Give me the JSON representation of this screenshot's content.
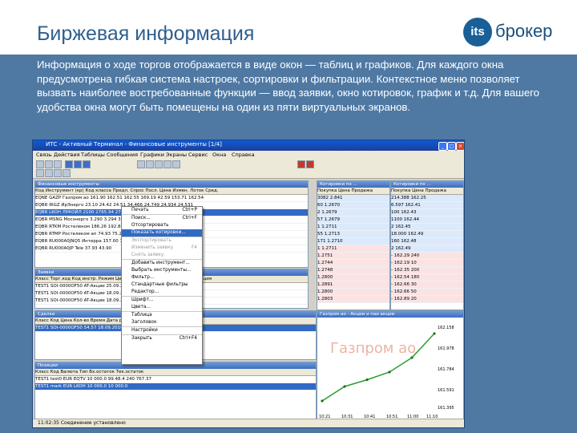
{
  "slide": {
    "title": "Биржевая информация",
    "logo_mark": "its",
    "logo_text": "брокер",
    "description": "Информация о ходе торгов отображается в виде окон — таблиц и графиков. Для каждого окна предусмотрена гибкая система настроек, сортировки и фильтрации. Контекстное меню позволяет вызвать наиболее востребованные функции — ввод заявки, окно котировок, график и т.д. Для вашего удобства окна могут быть помещены на один из пяти виртуальных экранов."
  },
  "app": {
    "title": "ИТС - Активный Терминал - Финансовые инструменты [1/4]",
    "menu": [
      "Связь",
      "Действия",
      "Таблицы",
      "Сообщения",
      "Графики",
      "Экраны",
      "Сервис",
      "Окна",
      "Справка"
    ],
    "status": "11:02:35 Соединение установлено"
  },
  "instruments": {
    "title": "Финансовые инструменты",
    "columns": "Код    Инструмент (кр)    Код класса    Предл.    Спрос    Посл.    Цена    Измен.    Лоток    Сред.",
    "rows": [
      "EQNE  GAZP   Газпром ао   161.90  162.51  162.55  169.19  42.59  153.71  162.54",
      "EQBR  IRGZ   ИрЭнерго   23.10  24.42  24.51  34.466  24.749  24.934  24.531",
      "EQBR  LKOH   ЛУКОЙЛ   2100  2765.94  2765.50  2765.00  2763.70  2754.00",
      "EQBR  MSNG   Мосэнерго   3.290  3.294  3.340  3.245  3.247",
      "EQBR  RTKM   Ростелеком   186.26  192.86  183.03  186.34",
      "EQBR  RTMP   Ростелеком ап   74.93  75.20  74.80",
      "EQBR  RU000A0JNQ5   Интерра   157.00  155.01  149.77  152.55",
      "EQBR  RU000A0JP   Tele   37.93  43.90"
    ]
  },
  "quotes1": {
    "title": "Котировки по ...",
    "columns": "Покупка   Цена   Продажа",
    "rows": [
      "3082   2.841",
      "60   1.2670",
      "2   1.2679",
      "57   1.2679",
      "1   1.2711",
      "55   1.2713",
      "171   1.2710",
      "1   1.2711",
      "   1.2751",
      "   1.2744",
      "   1.2748",
      "   1.2800",
      "   1.2891",
      "   1.2800",
      "   1.2803"
    ]
  },
  "quotes2": {
    "title": "Котировки по ...",
    "columns": "Покупка   Цена   Продажа",
    "rows": [
      "214.388  162.25",
      "6.597  162.41",
      "100  162.43",
      "1100  162.44",
      "2  162.45",
      "18.000  162.49",
      "160  162.48",
      "2  162.49",
      "-  162.29  240",
      "-  162.19  10",
      "-  162.35  200",
      "-  162.54  180",
      "-  162.66  30",
      "-  162.66  50",
      "-  162.89  20"
    ]
  },
  "orders": {
    "title": "Заявки",
    "columns": "Класс   Торг.код   Код инстр.   Режим   Цена   Кол-во   Время   Статус   Тип   Операция",
    "rows": [
      "TEST1  SOI-0000OF50  AT-Акции   25.09.20  Лимитированная  Пост",
      "TEST1  SOI-0000OF50  AT-Акции   18.09.20  Лимитированная  Пост",
      "TEST1  SOI-0000OF50  AT-Акции   18.09.20  Лимитированная  Пост"
    ]
  },
  "trades": {
    "title": "Сделки",
    "columns": "Класс   Код   Цена   Кол-во   Время   Дата расчетов   Статус   Операция",
    "rows": [
      "TEST1  SOI-0000OF50   54.57   18.09.2010   Активная   Пост"
    ]
  },
  "positions": {
    "title": "Позиции",
    "columns": "Класс   Код   Валюта   Тип   Вх.остаток   Тек.остаток",
    "rows": [
      "TEST1  test0   EUR   EQTV   10 000.0   99.48.4   240 767.37",
      "TEST1  mark   EUR   LKOH   10 000.0   10 000.0"
    ]
  },
  "context_menu": {
    "items": [
      {
        "label": "Печать",
        "shortcut": "Ctrl+P"
      },
      {
        "label": "Поиск...",
        "shortcut": "Ctrl+F"
      },
      {
        "label": "Отсортировать",
        "shortcut": ""
      },
      {
        "label": "Показать котировки...",
        "shortcut": ""
      },
      {
        "label": "Экспортировать",
        "shortcut": ""
      },
      {
        "label": "Изменить заявку",
        "shortcut": "F4"
      },
      {
        "label": "Снять заявку",
        "shortcut": ""
      },
      {
        "label": "Добавить инструмент...",
        "shortcut": ""
      },
      {
        "label": "Выбрать инструменты...",
        "shortcut": ""
      },
      {
        "label": "Фильтр...",
        "shortcut": ""
      },
      {
        "label": "Стандартные фильтры",
        "shortcut": ""
      },
      {
        "label": "Редактор...",
        "shortcut": ""
      },
      {
        "label": "Шрифт...",
        "shortcut": ""
      },
      {
        "label": "Цвета...",
        "shortcut": ""
      },
      {
        "label": "Таблица",
        "shortcut": ""
      },
      {
        "label": "Заголовок",
        "shortcut": ""
      },
      {
        "label": "Настройки",
        "shortcut": ""
      },
      {
        "label": "Закрыть",
        "shortcut": "Ctrl+F4"
      }
    ]
  },
  "chart": {
    "title": "Газпром ао - Акции и паи акции",
    "watermark": "Газпром ао",
    "y_ticks": [
      "162.158",
      "161.978",
      "161.784",
      "161.591",
      "161.395"
    ],
    "x_ticks": [
      "10:21",
      "10:31",
      "10:41",
      "10:51",
      "11:00",
      "11:10"
    ]
  },
  "chart_data": {
    "type": "line",
    "title": "Газпром ао - Акции и паи акции",
    "x": [
      "10:21",
      "10:31",
      "10:41",
      "10:51",
      "11:00",
      "11:10"
    ],
    "series": [
      {
        "values": [
          161.4,
          161.55,
          161.62,
          161.7,
          161.85,
          162.1
        ]
      }
    ],
    "ylim": [
      161.3,
      162.2
    ]
  }
}
